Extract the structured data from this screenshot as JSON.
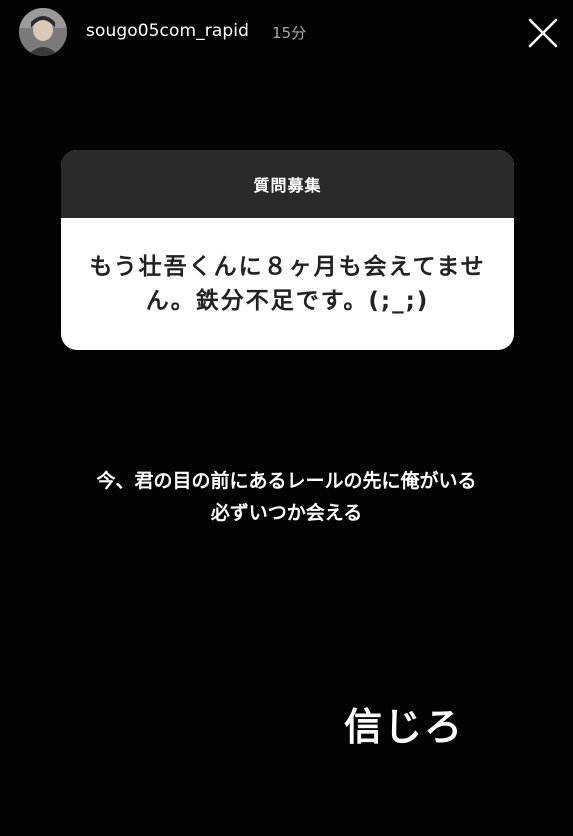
{
  "header": {
    "username": "sougo05com_rapid",
    "time": "15分",
    "avatar_icon": "profile-photo",
    "close_icon": "close-x-icon"
  },
  "question_box": {
    "title": "質問募集",
    "text": "もう壮吾くんに８ヶ月も会えてません。鉄分不足です。(;_;)"
  },
  "caption": {
    "line1": "今、君の目の前にあるレールの先に俺がいる",
    "line2": "必ずいつか会える"
  },
  "sticker": {
    "text": "信じろ"
  },
  "colors": {
    "background": "#030303",
    "question_header": "#2a2a2a",
    "question_body": "#ffffff",
    "text_primary": "#ffffff",
    "text_dark": "#222222",
    "time_gray": "#a9a9a9"
  }
}
